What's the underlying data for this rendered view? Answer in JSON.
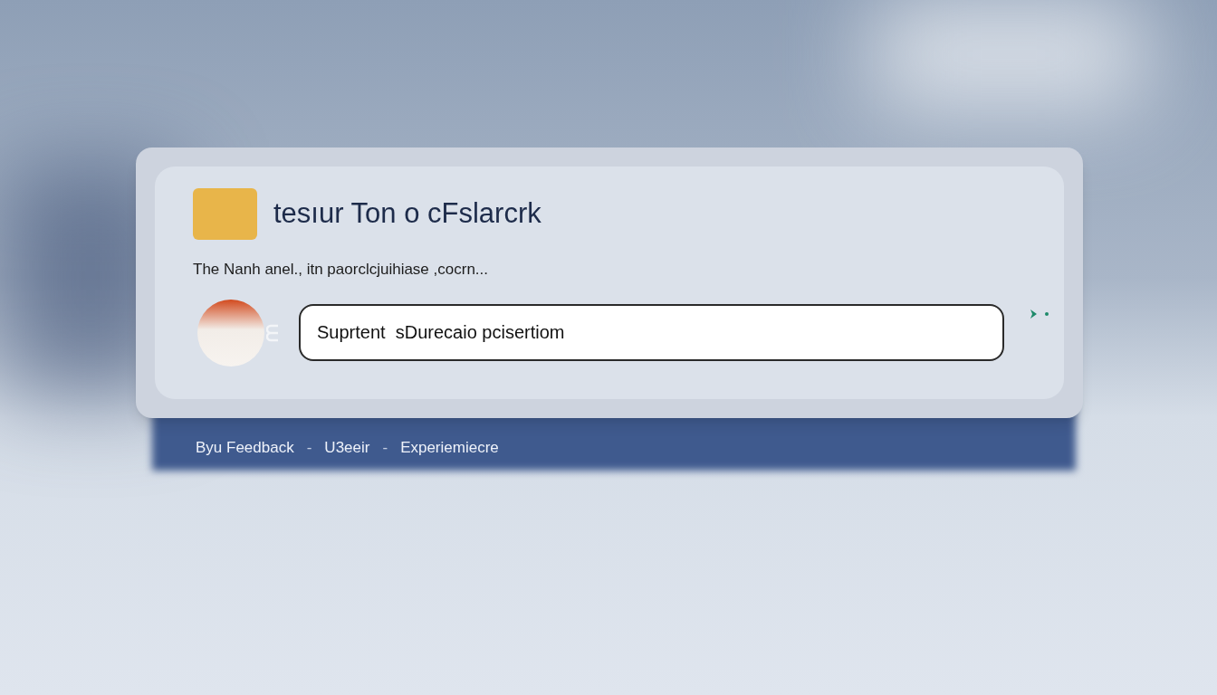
{
  "card": {
    "title": "tesıur Ton o cFslarcrk",
    "subtitle": "The Nanh anel.,  itn paorclcjuihiase ,cocrn...",
    "input": {
      "value": "Suprtent  sDurecaio pcisertiom"
    }
  },
  "footer": {
    "items": [
      {
        "kind": "link",
        "text": "Byu Feedback"
      },
      {
        "kind": "separator",
        "text": "-"
      },
      {
        "kind": "link",
        "text": "U3eeir"
      },
      {
        "kind": "separator",
        "text": "-"
      },
      {
        "kind": "link",
        "text": "Experiemiecre"
      }
    ]
  }
}
